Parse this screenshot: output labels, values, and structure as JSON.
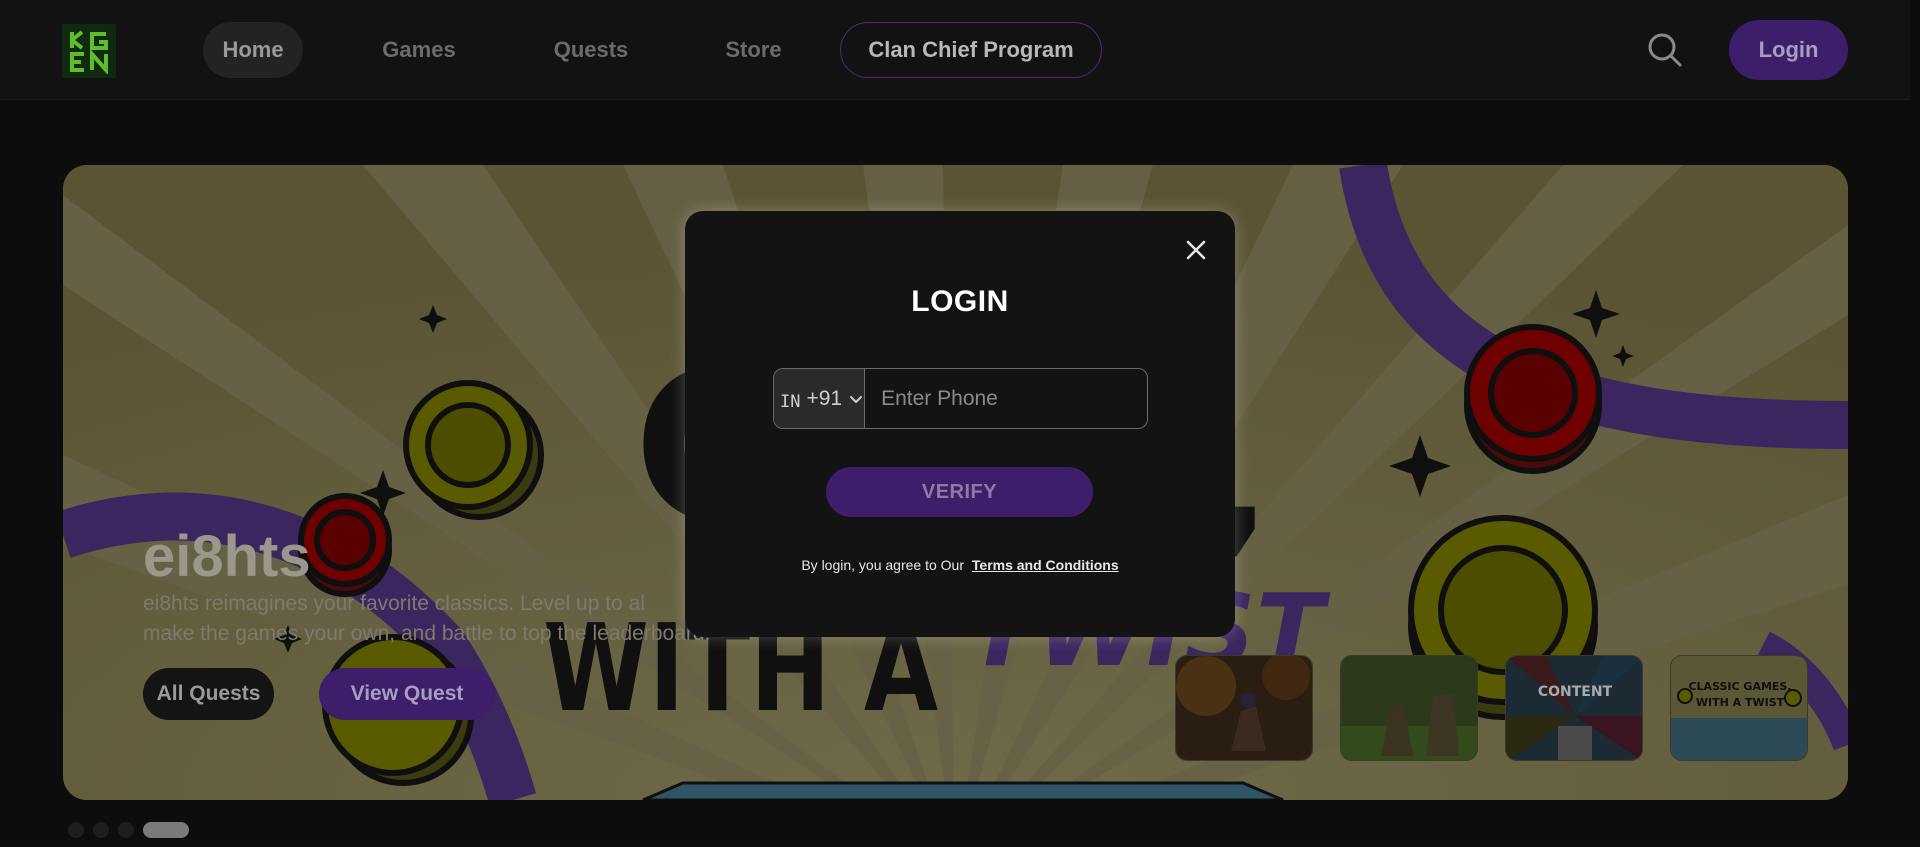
{
  "nav": {
    "logo_text": "KGEN",
    "links": [
      "Home",
      "Games",
      "Quests",
      "Store"
    ],
    "clan_label": "Clan Chief Program",
    "login_label": "Login",
    "search_icon": "search-icon"
  },
  "hero": {
    "title": "ei8hts",
    "description": "ei8hts reimagines your favorite classics. Level up to al... make the games your own, and battle to top the leaderboard.",
    "description_line1": "ei8hts reimagines your favorite classics. Level up to al",
    "description_line2": "make the games your own, and battle to top the leaderboard.",
    "all_quests_label": "All Quests",
    "view_quest_label": "View Quest",
    "art_text_big": "C",
    "art_text_twist": "WITH A TWIST",
    "thumbnails": [
      {
        "label": ""
      },
      {
        "label": ""
      },
      {
        "label": "CONTENT"
      },
      {
        "label": "CLASSIC GAMES, WITH A TWIST"
      }
    ],
    "slide_count": 4,
    "active_slide": 4
  },
  "modal": {
    "title": "LOGIN",
    "country_flag": "IN",
    "country_code": "+91",
    "phone_placeholder": "Enter Phone",
    "verify_label": "VERIFY",
    "terms_prefix": "By login, you agree to Our",
    "terms_link": "Terms and Conditions"
  },
  "colors": {
    "accent": "#5a2d9c",
    "background": "#0d0d0d",
    "modal_bg": "#131313"
  }
}
